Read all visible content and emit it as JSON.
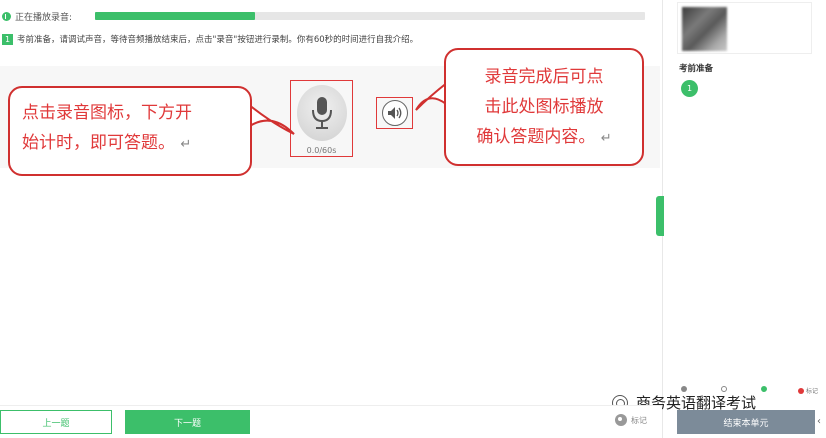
{
  "status": {
    "label": "正在播放录音:",
    "progress_percent": 29
  },
  "instruction": {
    "number": "1",
    "text": "考前准备，请调试声音，等待音频播放结束后，点击\"录音\"按钮进行录制。你有60秒的时间进行自我介绍。"
  },
  "recorder": {
    "time": "0.0/60s",
    "mic_icon": "microphone-icon",
    "play_icon": "speaker-icon"
  },
  "callouts": {
    "left_line1": "点击录音图标，下方开",
    "left_line2": "始计时，即可答题。",
    "right_line1": "录音完成后可点",
    "right_line2": "击此处图标播放",
    "right_line3": "确认答题内容。",
    "return_mark": "↵"
  },
  "side": {
    "section_title": "考前准备",
    "question_number": "1",
    "legend_last": "标记"
  },
  "watermark": {
    "text": "商务英语翻译考试"
  },
  "bottom": {
    "prev_label": "上一题",
    "next_label": "下一题",
    "mark_label": "标记",
    "end_label": "结束本单元",
    "collapse_icon": "‹"
  },
  "colors": {
    "accent": "#3cbf6a",
    "callout_red": "#e0393a",
    "end_button": "#7c8b99"
  }
}
